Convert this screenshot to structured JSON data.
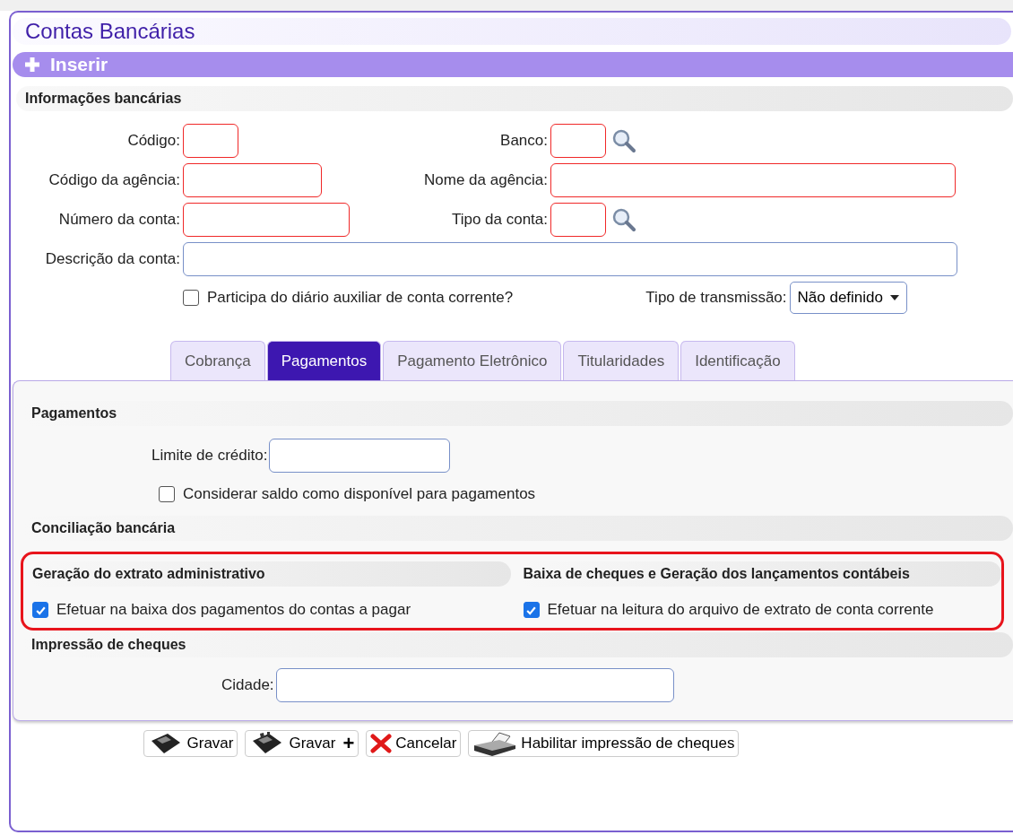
{
  "window": {
    "title": "Contas Bancárias"
  },
  "insert_bar": {
    "label": "Inserir"
  },
  "bank_info": {
    "title": "Informações bancárias",
    "rows": [
      {
        "left": {
          "label": "Código:",
          "required": true
        },
        "right": {
          "label": "Banco:",
          "required": true,
          "lookup": true
        }
      },
      {
        "left": {
          "label": "Código da agência:",
          "required": true
        },
        "right": {
          "label": "Nome da agência:",
          "required": true,
          "lookup": false
        }
      },
      {
        "left": {
          "label": "Número da conta:",
          "required": true
        },
        "right": {
          "label": "Tipo da conta:",
          "required": true,
          "lookup": true
        }
      }
    ],
    "description": {
      "label": "Descrição da conta:",
      "required": false
    },
    "diary_checkbox": {
      "label": "Participa do diário auxiliar de conta corrente?",
      "checked": false
    },
    "transmission": {
      "label": "Tipo de transmissão:",
      "value": "Não definido"
    }
  },
  "tabs": [
    {
      "label": "Cobrança",
      "selected": false
    },
    {
      "label": "Pagamentos",
      "selected": true
    },
    {
      "label": "Pagamento Eletrônico",
      "selected": false
    },
    {
      "label": "Titularidades",
      "selected": false
    },
    {
      "label": "Identificação",
      "selected": false
    }
  ],
  "payments": {
    "title": "Pagamentos",
    "credit_limit": {
      "label": "Limite de crédito:"
    },
    "balance_checkbox": {
      "label": "Considerar saldo como disponível para pagamentos",
      "checked": false
    }
  },
  "reconciliation": {
    "title": "Conciliação bancária",
    "highlighted": true,
    "columns": [
      {
        "title": "Geração do extrato administrativo",
        "checkbox": {
          "label": "Efetuar na baixa dos pagamentos do contas a pagar",
          "checked": true
        }
      },
      {
        "title": "Baixa de cheques e Geração dos lançamentos contábeis",
        "checkbox": {
          "label": "Efetuar na leitura do arquivo de extrato de conta corrente",
          "checked": true
        }
      }
    ]
  },
  "check_printing": {
    "title": "Impressão de cheques",
    "city": {
      "label": "Cidade:"
    }
  },
  "buttons": [
    {
      "kind": "save",
      "label": "Gravar"
    },
    {
      "kind": "save_new",
      "label": "Gravar",
      "suffix": "+"
    },
    {
      "kind": "cancel",
      "label": "Cancelar"
    },
    {
      "kind": "print",
      "label": "Habilitar impressão de cheques"
    }
  ]
}
